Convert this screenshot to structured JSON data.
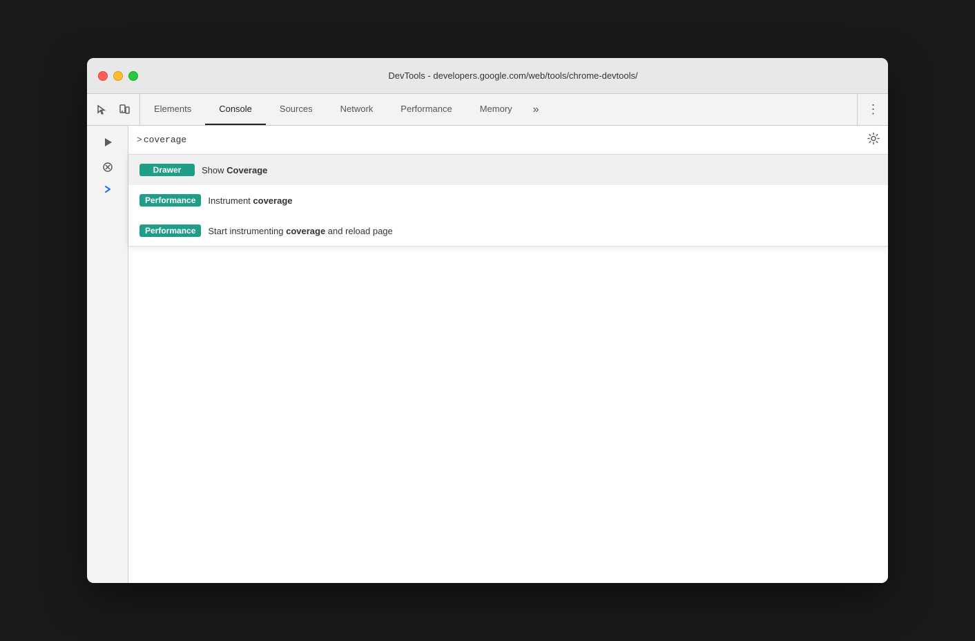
{
  "window": {
    "title": "DevTools - developers.google.com/web/tools/chrome-devtools/"
  },
  "traffic_lights": {
    "close_label": "close",
    "minimize_label": "minimize",
    "maximize_label": "maximize"
  },
  "toolbar": {
    "tabs": [
      {
        "id": "elements",
        "label": "Elements",
        "active": false
      },
      {
        "id": "console",
        "label": "Console",
        "active": true
      },
      {
        "id": "sources",
        "label": "Sources",
        "active": false
      },
      {
        "id": "network",
        "label": "Network",
        "active": false
      },
      {
        "id": "performance",
        "label": "Performance",
        "active": false
      },
      {
        "id": "memory",
        "label": "Memory",
        "active": false
      }
    ],
    "overflow_label": "»",
    "more_label": "⋮"
  },
  "console": {
    "prompt": ">",
    "input_value": "coverage"
  },
  "autocomplete": {
    "items": [
      {
        "id": "show-coverage",
        "tag": "Drawer",
        "tag_type": "drawer",
        "text_prefix": "Show ",
        "text_bold": "Coverage",
        "text_suffix": ""
      },
      {
        "id": "instrument-coverage",
        "tag": "Performance",
        "tag_type": "performance",
        "text_prefix": "Instrument ",
        "text_bold": "coverage",
        "text_suffix": ""
      },
      {
        "id": "start-instrument-coverage",
        "tag": "Performance",
        "tag_type": "performance",
        "text_prefix": "Start instrumenting ",
        "text_bold": "coverage",
        "text_suffix": " and reload page"
      }
    ]
  }
}
